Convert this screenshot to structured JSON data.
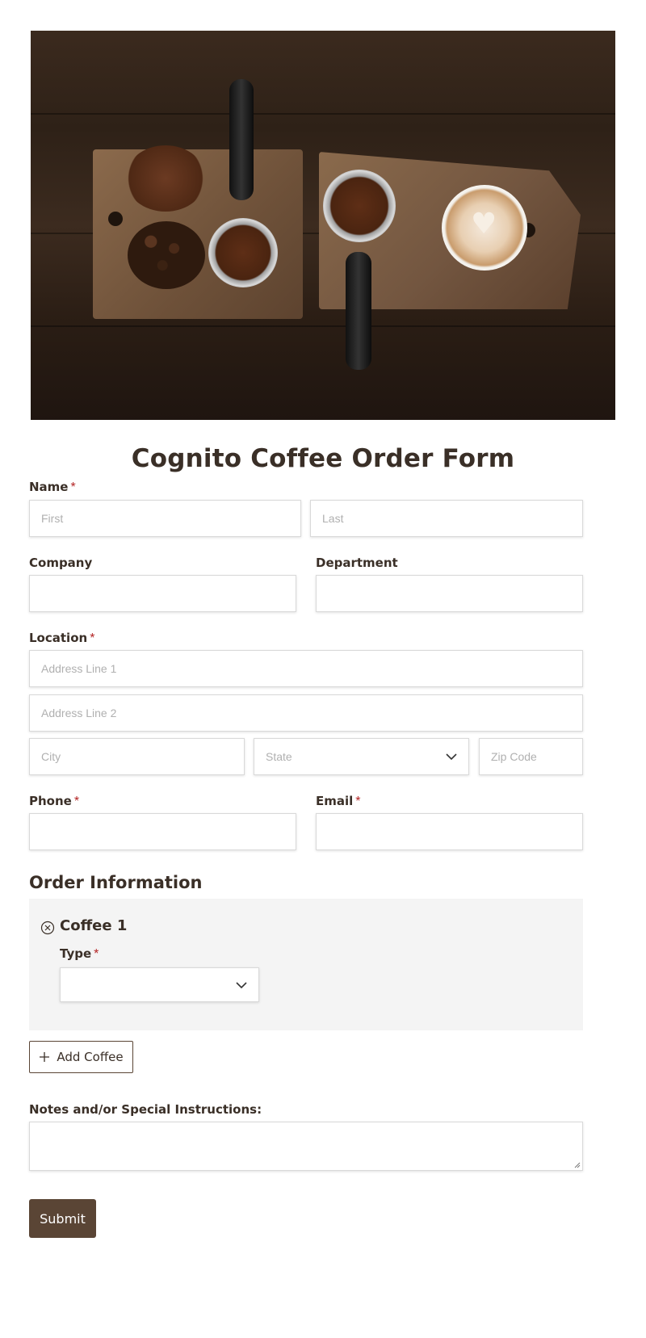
{
  "hero": {
    "image_alt": "Coffee grounds, beans, portafilters and a latte on wooden boards"
  },
  "form": {
    "title": "Cognito Coffee Order Form",
    "name": {
      "label": "Name",
      "required": "*",
      "first_placeholder": "First",
      "last_placeholder": "Last"
    },
    "company": {
      "label": "Company"
    },
    "department": {
      "label": "Department"
    },
    "location": {
      "label": "Location",
      "required": "*",
      "address1_placeholder": "Address Line 1",
      "address2_placeholder": "Address Line 2",
      "city_placeholder": "City",
      "state_placeholder": "State",
      "zip_placeholder": "Zip Code"
    },
    "phone": {
      "label": "Phone",
      "required": "*"
    },
    "email": {
      "label": "Email",
      "required": "*"
    },
    "order": {
      "section_title": "Order Information",
      "item_title": "Coffee 1",
      "type_label": "Type",
      "type_required": "*",
      "type_value": "",
      "add_button": "Add Coffee"
    },
    "notes": {
      "label": "Notes and/or Special Instructions:"
    },
    "submit": "Submit"
  },
  "icons": {
    "chevron": "chevron-down-icon",
    "remove": "circle-x-icon",
    "add": "plus-icon",
    "resize": "resize-handle-icon"
  },
  "colors": {
    "text": "#3a2f27",
    "required": "#b32424",
    "button": "#5a4535",
    "panel": "#f4f4f4",
    "placeholder": "#b0b0b0"
  }
}
